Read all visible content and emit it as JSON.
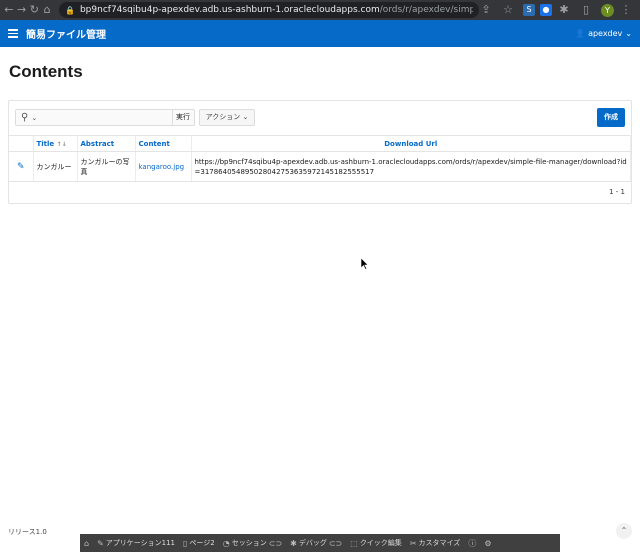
{
  "browser": {
    "url_host": "bp9ncf74sqibu4p-apexdev.adb.us-ashburn-1.oraclecloudapps.com",
    "url_path": "/ords/r/apexdev/simple-file-man...",
    "profile_initial": "Y"
  },
  "header": {
    "app_title": "簡易ファイル管理",
    "user": "apexdev"
  },
  "page": {
    "title": "Contents"
  },
  "toolbar": {
    "search_value": "",
    "go_label": "実行",
    "actions_label": "アクション",
    "create_label": "作成"
  },
  "table": {
    "columns": [
      "Title",
      "Abstract",
      "Content",
      "Download Url"
    ],
    "rows": [
      {
        "title": "カンガルー",
        "abstract": "カンガルーの写真",
        "content": "kangaroo.jpg",
        "download_url": "https://bp9ncf74sqibu4p-apexdev.adb.us-ashburn-1.oraclecloudapps.com/ords/r/apexdev/simple-file-manager/download?id=317864054895028042753635972145182555517"
      }
    ],
    "pagination": "1 - 1"
  },
  "footer": {
    "release": "リリース1.0",
    "dev_toolbar": [
      "アプリケーション111",
      "ページ2",
      "セッション",
      "デバッグ",
      "クイック編集",
      "カスタマイズ"
    ]
  },
  "colors": {
    "accent": "#056ac8",
    "chrome": "#35363a"
  }
}
